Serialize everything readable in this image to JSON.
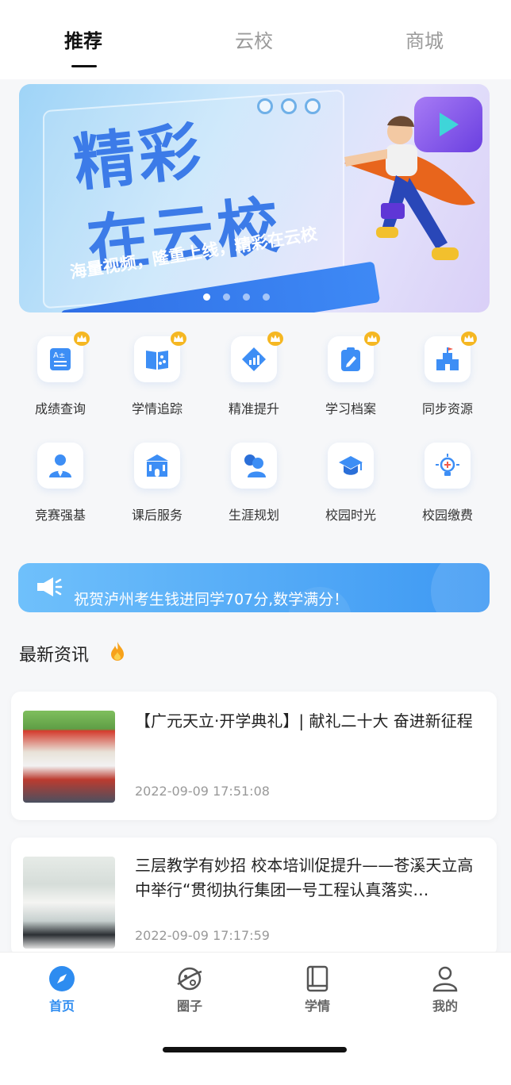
{
  "top_tabs": [
    {
      "label": "推荐",
      "active": true
    },
    {
      "label": "云校",
      "active": false
    },
    {
      "label": "商城",
      "active": false
    }
  ],
  "banner": {
    "title_line1": "精彩",
    "title_line2": "在云校",
    "slogan": "海量视频，隆重上线，精彩在云校",
    "page_count": 4,
    "active_page": 1
  },
  "grid": [
    {
      "label": "成绩查询",
      "icon": "report-icon",
      "vip": true
    },
    {
      "label": "学情追踪",
      "icon": "book-share-icon",
      "vip": true
    },
    {
      "label": "精准提升",
      "icon": "chart-diamond-icon",
      "vip": true
    },
    {
      "label": "学习档案",
      "icon": "clipboard-pen-icon",
      "vip": true
    },
    {
      "label": "同步资源",
      "icon": "school-building-icon",
      "vip": true
    },
    {
      "label": "竞赛强基",
      "icon": "person-tie-icon",
      "vip": false
    },
    {
      "label": "课后服务",
      "icon": "building-icon",
      "vip": false
    },
    {
      "label": "生涯规划",
      "icon": "users-icon",
      "vip": false
    },
    {
      "label": "校园时光",
      "icon": "graduation-cap-icon",
      "vip": false
    },
    {
      "label": "校园缴费",
      "icon": "lightbulb-icon",
      "vip": false
    }
  ],
  "notice": {
    "text": "祝贺泸州考生钱进同学707分,数学满分！",
    "icon": "megaphone-icon"
  },
  "news": {
    "section_title": "最新资讯",
    "items": [
      {
        "title": "【广元天立·开学典礼】| 献礼二十大 奋进新征程",
        "date": "2022-09-09 17:51:08"
      },
      {
        "title": "三层教学有妙招 校本培训促提升——苍溪天立高中举行“贯彻执行集团一号工程认真落实…",
        "date": "2022-09-09 17:17:59"
      }
    ]
  },
  "tabbar": [
    {
      "label": "首页",
      "icon": "compass-icon",
      "active": true
    },
    {
      "label": "圈子",
      "icon": "planet-icon",
      "active": false
    },
    {
      "label": "学情",
      "icon": "book-icon",
      "active": false
    },
    {
      "label": "我的",
      "icon": "user-icon",
      "active": false
    }
  ],
  "colors": {
    "accent": "#2e8cf0",
    "vip": "#f5b722"
  }
}
